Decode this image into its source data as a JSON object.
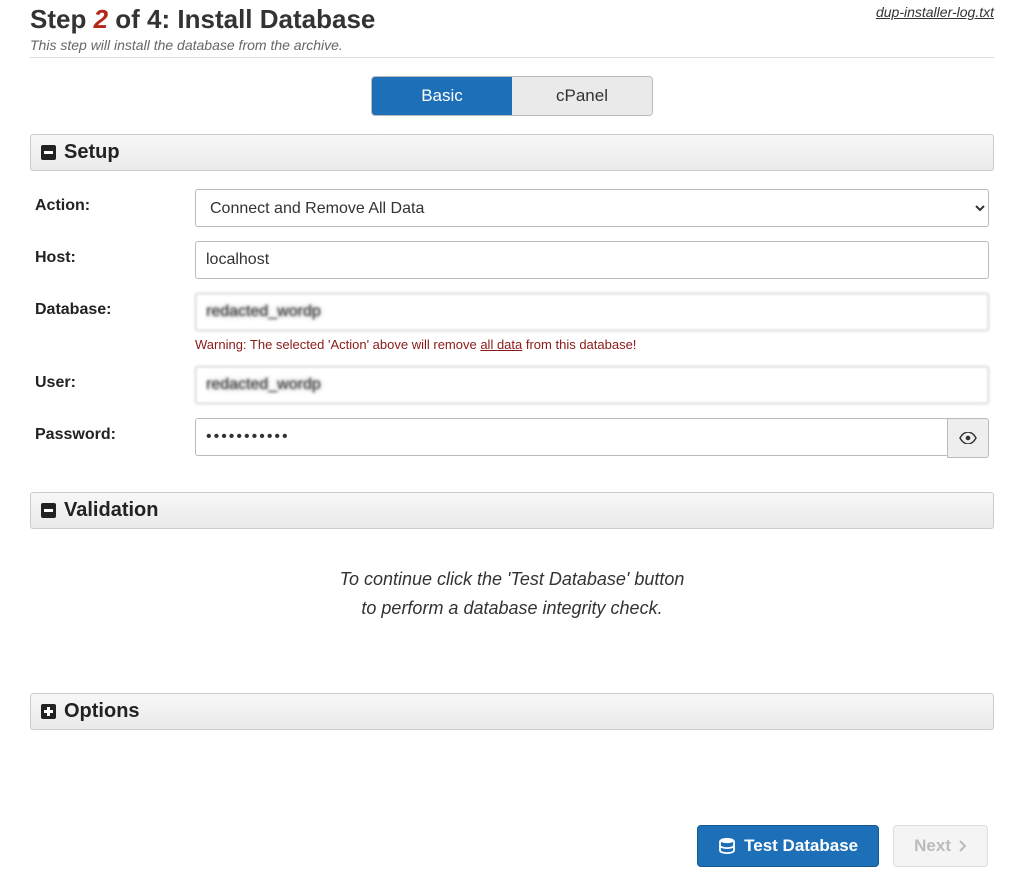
{
  "header": {
    "step_prefix": "Step ",
    "step_num": "2",
    "step_mid": " of 4: ",
    "step_title": "Install Database",
    "subtitle": "This step will install the database from the archive.",
    "log_link": "dup-installer-log.txt"
  },
  "tabs": {
    "basic": "Basic",
    "cpanel": "cPanel"
  },
  "setup": {
    "title": "Setup",
    "action_label": "Action:",
    "action_value": "Connect and Remove All Data",
    "host_label": "Host:",
    "host_value": "localhost",
    "db_label": "Database:",
    "db_value": "redacted_wordp",
    "db_warning_prefix": "Warning: The selected 'Action' above will remove ",
    "db_warning_link": "all data",
    "db_warning_suffix": " from this database!",
    "user_label": "User:",
    "user_value": "redacted_wordp",
    "pw_label": "Password:",
    "pw_value": "•••••••••••"
  },
  "validation": {
    "title": "Validation",
    "line1": "To continue click the 'Test Database' button",
    "line2": "to perform a database integrity check."
  },
  "options": {
    "title": "Options"
  },
  "buttons": {
    "test_db": "Test Database",
    "next": "Next"
  }
}
